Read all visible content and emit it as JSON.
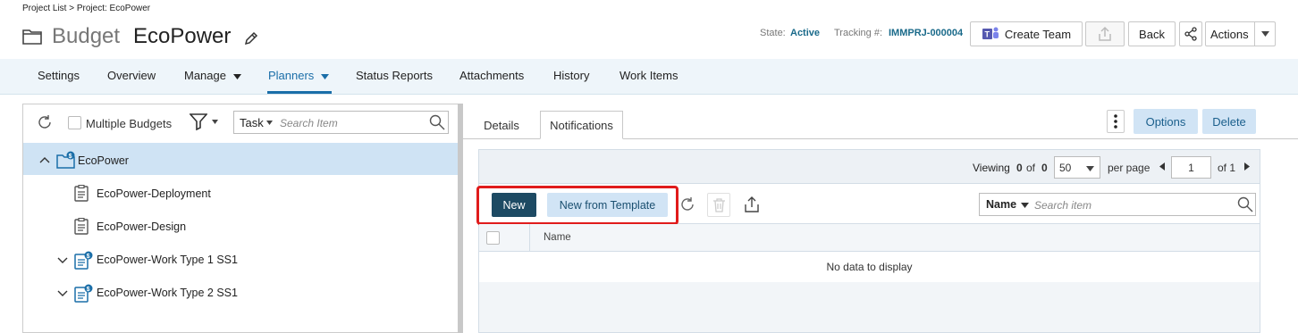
{
  "breadcrumb": "Project List > Project: EcoPower",
  "title": {
    "type": "Budget",
    "name": "EcoPower"
  },
  "status": {
    "state_label": "State:",
    "state_value": "Active",
    "tracking_label": "Tracking #:",
    "tracking_value": "IMMPRJ-000004"
  },
  "header_buttons": {
    "create_team": "Create Team",
    "back": "Back",
    "actions": "Actions"
  },
  "nav": {
    "items": [
      "Settings",
      "Overview",
      "Manage",
      "Planners",
      "Status Reports",
      "Attachments",
      "History",
      "Work Items"
    ],
    "active": "Planners"
  },
  "left_panel": {
    "multiple_budgets_label": "Multiple Budgets",
    "search_type": "Task",
    "search_placeholder": "Search Item",
    "tree": [
      {
        "label": "EcoPower",
        "selected": true,
        "icon": "budget-folder-icon"
      },
      {
        "label": "EcoPower-Deployment",
        "icon": "clipboard-icon"
      },
      {
        "label": "EcoPower-Design",
        "icon": "clipboard-icon"
      },
      {
        "label": "EcoPower-Work Type 1 SS1",
        "icon": "budget-doc-icon"
      },
      {
        "label": "EcoPower-Work Type 2 SS1",
        "icon": "budget-doc-icon"
      }
    ]
  },
  "right_panel": {
    "tabs": [
      "Details",
      "Notifications"
    ],
    "active_tab": "Notifications",
    "options": "Options",
    "delete": "Delete",
    "pager": {
      "viewing_label": "Viewing",
      "from": "0",
      "of_label": "of",
      "total": "0",
      "page_size": "50",
      "per_page": "per page",
      "page": "1",
      "page_of": "of 1"
    },
    "toolbar": {
      "new": "New",
      "new_from_template": "New from Template",
      "search_field": "Name",
      "search_placeholder": "Search item"
    },
    "grid": {
      "column_name": "Name",
      "empty": "No data to display"
    }
  },
  "colors": {
    "accent": "#1a6ea8",
    "primary_button": "#1d4a63",
    "secondary_button": "#d1e4f5",
    "highlight": "#e01b1b",
    "nav_bg": "#eef5fa"
  }
}
